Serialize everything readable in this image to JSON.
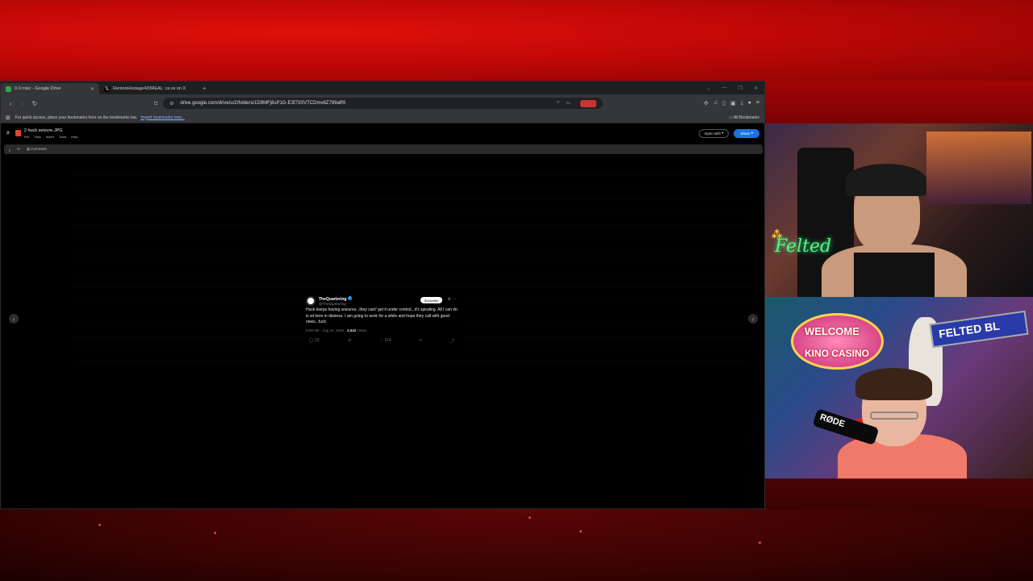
{
  "browser": {
    "tabs": [
      {
        "label": "0.0 misc - Google Drive",
        "active": true
      },
      {
        "label": "RentonHostage420REAL: xx.xx on X",
        "active": false
      }
    ],
    "address_url": "drive.google.com/drive/u/2/folders/1D9MFj8sP1G-E3f73SVTCDmx6Z799aRfi",
    "bookmarks_hint": "For quick access, place your bookmarks here on the bookmarks bar.",
    "bookmarks_import": "Import bookmarks now...",
    "all_bookmarks": "All Bookmarks"
  },
  "drive_viewer": {
    "file_name": "2 huck seizure.JPG",
    "menu": [
      "File",
      "View",
      "Insert",
      "Tools",
      "Help"
    ],
    "open_with": "Open with",
    "share": "Share",
    "comment": "Comment"
  },
  "tweet": {
    "name": "TheQuartering",
    "handle": "@TheQuartering",
    "subscribe": "Subscribe",
    "text": "Huck keeps having seizures...they cant' get it under control...it's spiraling. All I can do is sit here in distress. I am going to work for a while and hope they call with good news...fuck",
    "time": "9:59 AM · Aug 24, 2026 · ",
    "views": "3,542",
    "views_label": "Views",
    "replies": "23",
    "likes": "114"
  },
  "overlay": {
    "welcome": "WELCOME",
    "casino": "KINO CASINO",
    "felted_sign": "FELTED BL",
    "neon": "Felted",
    "mic_brand": "RØDE"
  },
  "colors": {
    "stream_red": "#c00806",
    "share_blue": "#1a73e8",
    "verified_blue": "#1d9bf0"
  }
}
